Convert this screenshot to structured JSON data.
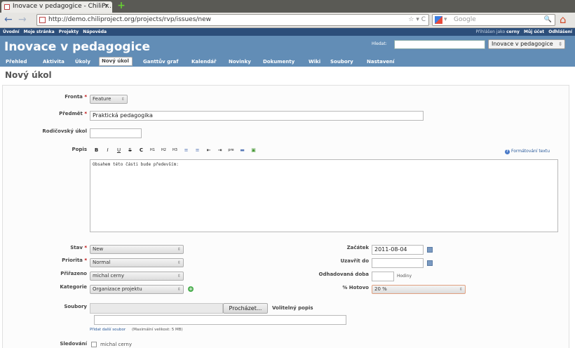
{
  "browser": {
    "tab_title": "Inovace v pedagogice - ChiliPr...",
    "tab_close": "×",
    "new_tab": "+",
    "back": "←",
    "forward": "→",
    "url": "http://demo.chiliproject.org/projects/rvp/issues/new",
    "url_controls": "☆ ▾ C",
    "search_placeholder": "Google",
    "search_engine_arrow": "▾",
    "search_icon": "🔍",
    "home_icon": "⌂"
  },
  "top_menu": {
    "left": [
      "Úvodní",
      "Moje stránka",
      "Projekty",
      "Nápověda"
    ],
    "logged_as_label": "Přihlášen jako",
    "user": "cerny",
    "right": [
      "Můj účet",
      "Odhlášení"
    ]
  },
  "header": {
    "title": "Inovace v pedagogice",
    "search_label": "Hledat:",
    "project_select": "Inovace v pedagogice"
  },
  "main_menu": [
    "Přehled",
    "Aktivita",
    "Úkoly",
    "Nový úkol",
    "Ganttův graf",
    "Kalendář",
    "Novinky",
    "Dokumenty",
    "Wiki",
    "Soubory",
    "Nastavení"
  ],
  "main_menu_selected": "Nový úkol",
  "page_title": "Nový úkol",
  "form": {
    "tracker_label": "Fronta",
    "tracker_value": "Feature",
    "subject_label": "Předmět",
    "subject_value": "Praktická pedagogika",
    "parent_label": "Rodičovský úkol",
    "parent_value": "",
    "description_label": "Popis",
    "toolbar_buttons": [
      "B",
      "I",
      "U",
      "S",
      "C",
      "H1",
      "H2",
      "H3",
      "≡",
      "≡",
      "⇤",
      "⇥",
      "pre",
      "▬",
      "▣"
    ],
    "formatting_help": "Formátování textu",
    "description_value": "Obsahem této části bude především:",
    "status_label": "Stav",
    "status_value": "New",
    "priority_label": "Priorita",
    "priority_value": "Normal",
    "assignee_label": "Přiřazeno",
    "assignee_value": "michal cerny",
    "category_label": "Kategorie",
    "category_value": "Organizace projektu",
    "start_label": "Začátek",
    "start_value": "2011-08-04",
    "due_label": "Uzavřít do",
    "due_value": "",
    "estimate_label": "Odhadovaná doba",
    "estimate_value": "",
    "hours_label": "Hodiny",
    "done_label": "% Hotovo",
    "done_value": "20 %",
    "files_label": "Soubory",
    "browse_button": "Procházet...",
    "optional_desc_label": "Volitelný popis",
    "add_file_link": "Přidat další soubor",
    "max_size_note": "(Maximální velikost: 5 MB)",
    "watchers_label": "Sledování",
    "watcher_name": "michal cerny"
  }
}
